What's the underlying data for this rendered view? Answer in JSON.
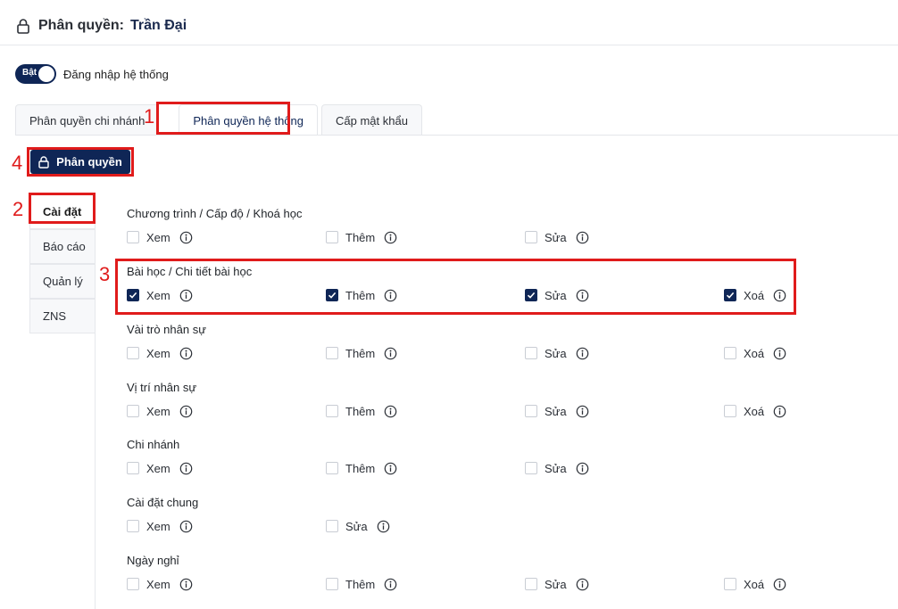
{
  "header": {
    "label": "Phân quyền:",
    "name": "Trần Đại"
  },
  "toggle": {
    "state_text": "Bật",
    "label": "Đăng nhập hệ thống"
  },
  "tabs": [
    {
      "label": "Phân quyền chi nhánh",
      "active": false
    },
    {
      "label": "Phân quyền hệ thống",
      "active": true
    },
    {
      "label": "Cấp mật khẩu",
      "active": false
    }
  ],
  "action_button": {
    "label": "Phân quyền"
  },
  "subnav": [
    {
      "label": "Cài đặt",
      "active": true
    },
    {
      "label": "Báo cáo",
      "active": false
    },
    {
      "label": "Quản lý",
      "active": false
    },
    {
      "label": "ZNS",
      "active": false
    }
  ],
  "annotations": {
    "n1": "1",
    "n2": "2",
    "n3": "3",
    "n4": "4"
  },
  "sections": [
    {
      "title": "Chương trình / Cấp độ / Khoá học",
      "options": [
        {
          "label": "Xem",
          "checked": false
        },
        {
          "label": "Thêm",
          "checked": false
        },
        {
          "label": "Sửa",
          "checked": false
        }
      ]
    },
    {
      "title": "Bài học / Chi tiết bài học",
      "options": [
        {
          "label": "Xem",
          "checked": true
        },
        {
          "label": "Thêm",
          "checked": true
        },
        {
          "label": "Sửa",
          "checked": true
        },
        {
          "label": "Xoá",
          "checked": true
        }
      ]
    },
    {
      "title": "Vài trò nhân sự",
      "options": [
        {
          "label": "Xem",
          "checked": false
        },
        {
          "label": "Thêm",
          "checked": false
        },
        {
          "label": "Sửa",
          "checked": false
        },
        {
          "label": "Xoá",
          "checked": false
        }
      ]
    },
    {
      "title": "Vị trí nhân sự",
      "options": [
        {
          "label": "Xem",
          "checked": false
        },
        {
          "label": "Thêm",
          "checked": false
        },
        {
          "label": "Sửa",
          "checked": false
        },
        {
          "label": "Xoá",
          "checked": false
        }
      ]
    },
    {
      "title": "Chi nhánh",
      "options": [
        {
          "label": "Xem",
          "checked": false
        },
        {
          "label": "Thêm",
          "checked": false
        },
        {
          "label": "Sửa",
          "checked": false
        }
      ]
    },
    {
      "title": "Cài đặt chung",
      "options": [
        {
          "label": "Xem",
          "checked": false
        },
        {
          "label": "Sửa",
          "checked": false
        }
      ]
    },
    {
      "title": "Ngày nghỉ",
      "options": [
        {
          "label": "Xem",
          "checked": false
        },
        {
          "label": "Thêm",
          "checked": false
        },
        {
          "label": "Sửa",
          "checked": false
        },
        {
          "label": "Xoá",
          "checked": false
        }
      ]
    }
  ],
  "colors": {
    "primary": "#0f2656",
    "annotation": "#e01b1b",
    "border": "#e4e6ea"
  }
}
